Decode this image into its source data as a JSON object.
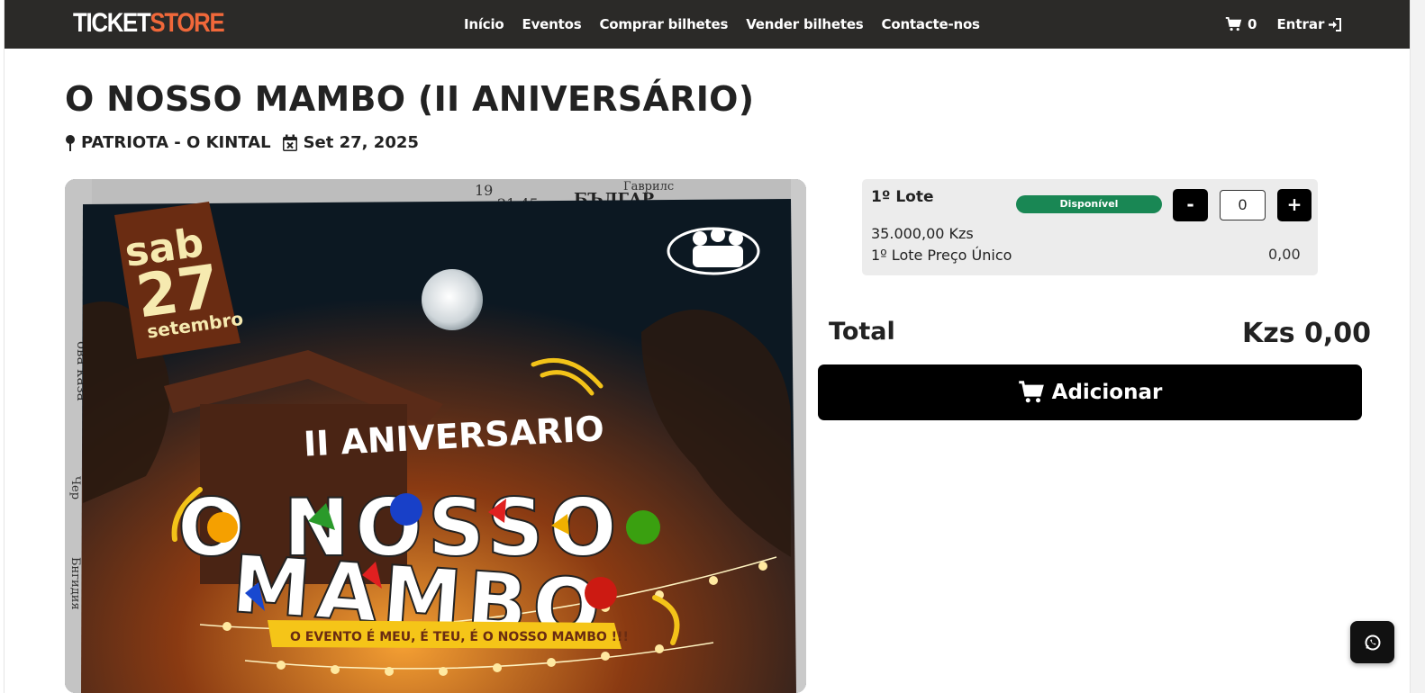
{
  "header": {
    "logo_part1": "TICKET",
    "logo_part2": "STORE",
    "nav": [
      "Início",
      "Eventos",
      "Comprar bilhetes",
      "Vender bilhetes",
      "Contacte-nos"
    ],
    "cart_count": "0",
    "login_label": "Entrar"
  },
  "event": {
    "title": "O NOSSO MAMBO (II ANIVERSÁRIO)",
    "venue": "PATRIOTA - O KINTAL",
    "date": "Set 27, 2025"
  },
  "poster": {
    "badge_day_name": "sab",
    "badge_day": "27",
    "badge_month": "setembro",
    "subtitle": "II ANIVERSARIO",
    "headline_line1": "O NOSSO",
    "headline_line2": "MAMBO",
    "tagline": "O EVENTO É MEU, É TEU, É O NOSSO MAMBO !!!",
    "newspaper_fragments": [
      "19",
      "21.45",
      "БЪЛГАР",
      "Гаврилс",
      "ова каза",
      "Чер",
      "Бнгидия"
    ]
  },
  "ticket": {
    "lote_name": "1º Lote",
    "status": "Disponível",
    "minus_label": "-",
    "plus_label": "+",
    "quantity": "0",
    "price": "35.000,00 Kzs",
    "description": "1º Lote Preço Único",
    "subtotal": "0,00"
  },
  "summary": {
    "total_label": "Total",
    "total_value": "Kzs 0,00",
    "add_label": "Adicionar"
  },
  "colors": {
    "navbar": "#2b2a28",
    "logo_accent": "#f0683a",
    "badge_green": "#198754",
    "button_black": "#000000"
  },
  "icons": [
    "cart-icon",
    "sign-in-icon",
    "map-pin-icon",
    "calendar-x-icon",
    "whatsapp-icon"
  ]
}
